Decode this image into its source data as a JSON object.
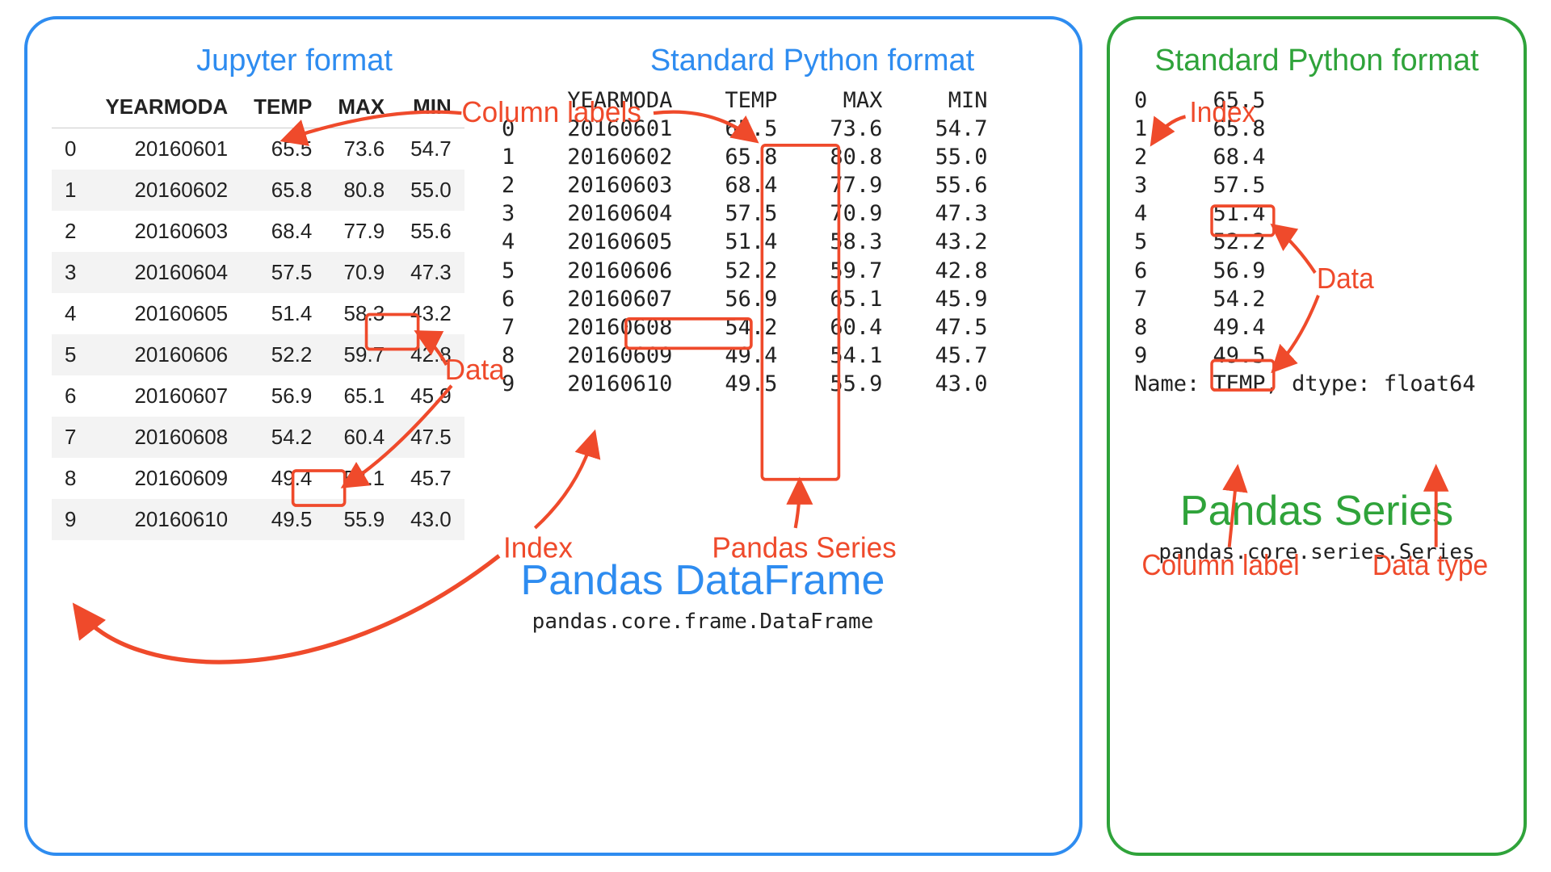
{
  "annotations": {
    "column_labels": "Column labels",
    "data": "Data",
    "index": "Index",
    "pandas_series": "Pandas Series",
    "column_label": "Column label",
    "data_type": "Data type"
  },
  "dataframe": {
    "jupyter_heading": "Jupyter format",
    "std_heading": "Standard Python format",
    "title": "Pandas DataFrame",
    "classpath": "pandas.core.frame.DataFrame",
    "columns": [
      "YEARMODA",
      "TEMP",
      "MAX",
      "MIN"
    ],
    "index": [
      0,
      1,
      2,
      3,
      4,
      5,
      6,
      7,
      8,
      9
    ],
    "rows": [
      [
        "20160601",
        "65.5",
        "73.6",
        "54.7"
      ],
      [
        "20160602",
        "65.8",
        "80.8",
        "55.0"
      ],
      [
        "20160603",
        "68.4",
        "77.9",
        "55.6"
      ],
      [
        "20160604",
        "57.5",
        "70.9",
        "47.3"
      ],
      [
        "20160605",
        "51.4",
        "58.3",
        "43.2"
      ],
      [
        "20160606",
        "52.2",
        "59.7",
        "42.8"
      ],
      [
        "20160607",
        "56.9",
        "65.1",
        "45.9"
      ],
      [
        "20160608",
        "54.2",
        "60.4",
        "47.5"
      ],
      [
        "20160609",
        "49.4",
        "54.1",
        "45.7"
      ],
      [
        "20160610",
        "49.5",
        "55.9",
        "43.0"
      ]
    ]
  },
  "series": {
    "heading": "Standard Python format",
    "title": "Pandas Series",
    "classpath": "pandas.core.series.Series",
    "name_line_prefix": "Name: ",
    "name_value": "TEMP",
    "dtype_prefix": ", dtype: ",
    "dtype_value": "float64",
    "index": [
      0,
      1,
      2,
      3,
      4,
      5,
      6,
      7,
      8,
      9
    ],
    "values": [
      "65.5",
      "65.8",
      "68.4",
      "57.5",
      "51.4",
      "52.2",
      "56.9",
      "54.2",
      "49.4",
      "49.5"
    ]
  }
}
